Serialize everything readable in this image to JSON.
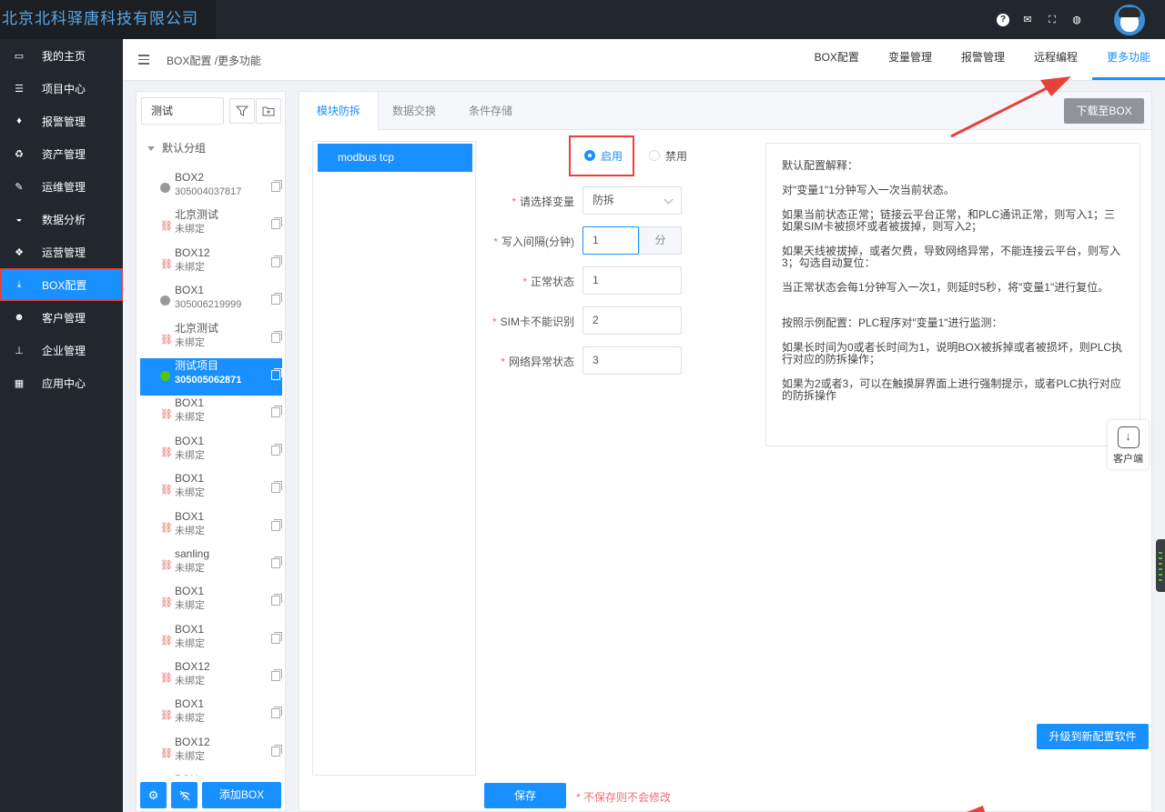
{
  "header": {
    "brand": "北京北科驿唐科技有限公司"
  },
  "sidebar": {
    "items": [
      {
        "label": "我的主页",
        "icon": "laptop-icon"
      },
      {
        "label": "项目中心",
        "icon": "list-icon"
      },
      {
        "label": "报警管理",
        "icon": "bell-icon"
      },
      {
        "label": "资产管理",
        "icon": "recycle-icon"
      },
      {
        "label": "运维管理",
        "icon": "wrench-icon"
      },
      {
        "label": "数据分析",
        "icon": "gauge-icon"
      },
      {
        "label": "运营管理",
        "icon": "cubes-icon"
      },
      {
        "label": "BOX配置",
        "icon": "download-icon"
      },
      {
        "label": "客户管理",
        "icon": "users-icon"
      },
      {
        "label": "企业管理",
        "icon": "sitemap-icon"
      },
      {
        "label": "应用中心",
        "icon": "grid-icon"
      }
    ],
    "active_index": 7
  },
  "subheader": {
    "breadcrumb": "BOX配置 /更多功能",
    "tabs": [
      "BOX配置",
      "变量管理",
      "报警管理",
      "远程编程",
      "更多功能"
    ],
    "active_tab": 4
  },
  "tree": {
    "search_value": "测试",
    "group": "默认分组",
    "items": [
      {
        "name": "BOX2",
        "sub": "305004037817",
        "state": "offline"
      },
      {
        "name": "北京测试",
        "sub": "未绑定",
        "state": "unbound"
      },
      {
        "name": "BOX12",
        "sub": "未绑定",
        "state": "unbound"
      },
      {
        "name": "BOX1",
        "sub": "305006219999",
        "state": "offline"
      },
      {
        "name": "北京测试",
        "sub": "未绑定",
        "state": "unbound"
      },
      {
        "name": "测试项目",
        "sub": "305005062871",
        "state": "online",
        "selected": true
      },
      {
        "name": "BOX1",
        "sub": "未绑定",
        "state": "unbound"
      },
      {
        "name": "BOX1",
        "sub": "未绑定",
        "state": "unbound"
      },
      {
        "name": "BOX1",
        "sub": "未绑定",
        "state": "unbound"
      },
      {
        "name": "BOX1",
        "sub": "未绑定",
        "state": "unbound"
      },
      {
        "name": "sanling",
        "sub": "未绑定",
        "state": "unbound"
      },
      {
        "name": "BOX1",
        "sub": "未绑定",
        "state": "unbound"
      },
      {
        "name": "BOX1",
        "sub": "未绑定",
        "state": "unbound"
      },
      {
        "name": "BOX12",
        "sub": "未绑定",
        "state": "unbound"
      },
      {
        "name": "BOX1",
        "sub": "未绑定",
        "state": "unbound"
      },
      {
        "name": "BOX12",
        "sub": "未绑定",
        "state": "unbound"
      },
      {
        "name": "BOX",
        "sub": "",
        "state": "unbound"
      }
    ],
    "add_label": "添加BOX"
  },
  "main": {
    "tabs": [
      "模块防拆",
      "数据交换",
      "条件存储"
    ],
    "active_tab": 0,
    "download_label": "下载至BOX",
    "protocol": "modbus tcp",
    "enable_label": "启用",
    "disable_label": "禁用",
    "form": [
      {
        "label": "请选择变量",
        "value": "防拆",
        "type": "select"
      },
      {
        "label": "写入间隔(分钟)",
        "value": "1",
        "type": "unit",
        "unit": "分"
      },
      {
        "label": "正常状态",
        "value": "1",
        "type": "input"
      },
      {
        "label": "SIM卡不能识别",
        "value": "2",
        "type": "input"
      },
      {
        "label": "网络异常状态",
        "value": "3",
        "type": "input"
      }
    ],
    "explanation": [
      "默认配置解释：",
      "对\"变量1\"1分钟写入一次当前状态。",
      "如果当前状态正常；链接云平台正常，和PLC通讯正常，则写入1；三如果SIM卡被损坏或者被拔掉，则写入2；",
      "如果天线被拔掉，或者欠费，导致网络异常，不能连接云平台，则写入3；勾选自动复位：",
      "当正常状态会每1分钟写入一次1，则延时5秒，将\"变量1\"进行复位。",
      "按照示例配置：PLC程序对\"变量1\"进行监测：",
      "如果长时间为0或者长时间为1，说明BOX被拆掉或者被损坏，则PLC执行对应的防拆操作；",
      "如果为2或者3，可以在触摸屏界面上进行强制提示，或者PLC执行对应的防拆操作"
    ],
    "save_label": "保存",
    "save_warning": "* 不保存则不会修改"
  },
  "floating": {
    "client_label": "客户端",
    "upgrade_label": "升级到新配置软件"
  },
  "colors": {
    "accent": "#1890ff",
    "sidebar_bg": "#22272e",
    "highlight_red": "#e8413b",
    "online": "#52c41a"
  }
}
